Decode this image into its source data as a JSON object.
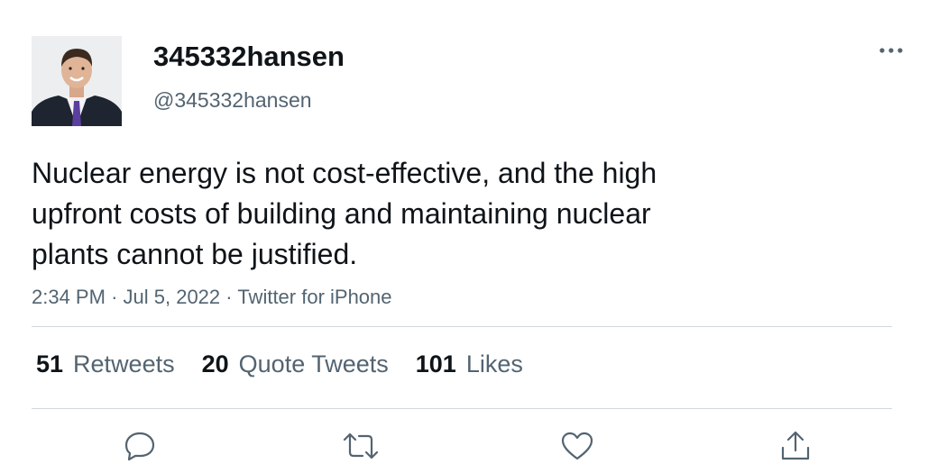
{
  "author": {
    "display_name": "345332hansen",
    "handle": "@345332hansen",
    "avatar_icon": "profile-photo"
  },
  "tweet": {
    "text": "Nuclear energy is not cost-effective, and the high\nupfront costs of building and maintaining nuclear\nplants cannot be justified.",
    "time": "2:34 PM",
    "date": "Jul 5, 2022",
    "source": "Twitter for iPhone",
    "separator": "·"
  },
  "stats": {
    "retweets": {
      "count": "51",
      "label": "Retweets"
    },
    "quote_tweets": {
      "count": "20",
      "label": "Quote Tweets"
    },
    "likes": {
      "count": "101",
      "label": "Likes"
    }
  },
  "actions": [
    {
      "icon": "reply-icon"
    },
    {
      "icon": "retweet-icon"
    },
    {
      "icon": "like-icon"
    },
    {
      "icon": "share-icon"
    }
  ],
  "colors": {
    "text_primary": "#0f1419",
    "text_secondary": "#536471",
    "divider": "#cfd9de"
  }
}
